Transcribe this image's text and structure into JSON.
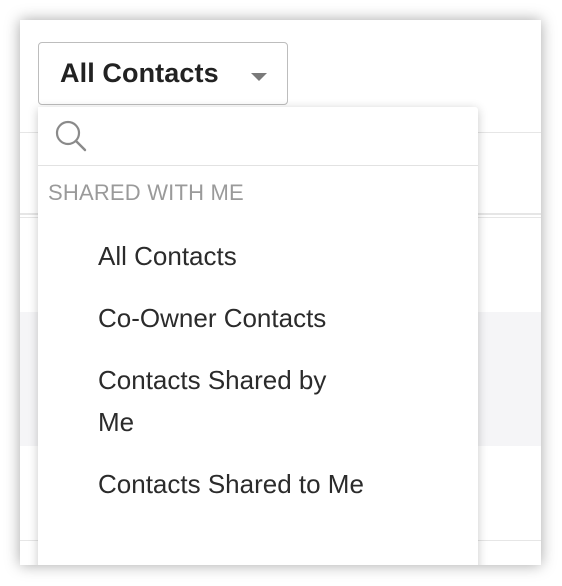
{
  "view_selector": {
    "label": "All Contacts"
  },
  "dropdown": {
    "search": {
      "placeholder": "",
      "value": ""
    },
    "section_title": "SHARED WITH ME",
    "items": [
      {
        "label": "All Contacts"
      },
      {
        "label": "Co-Owner Contacts"
      },
      {
        "label": "Contacts Shared by Me"
      },
      {
        "label": "Contacts Shared to Me"
      }
    ]
  },
  "icons": {
    "search": "search-icon",
    "caret": "chevron-down-icon"
  },
  "colors": {
    "section_title": "#9a9a9a",
    "item_text": "#2b2b2b",
    "caret": "#7a7a7a"
  }
}
